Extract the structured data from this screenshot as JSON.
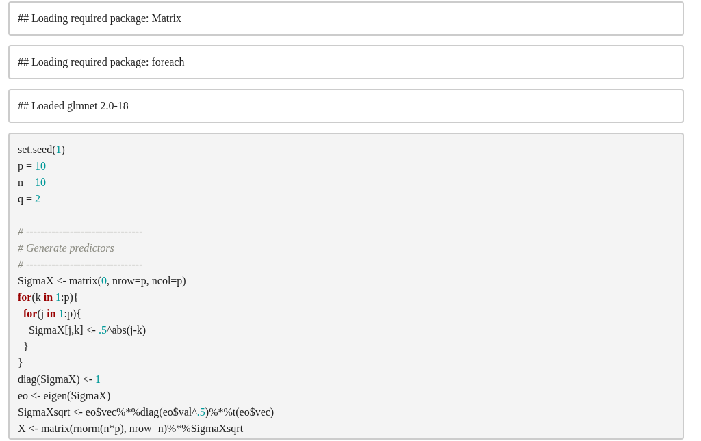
{
  "blocks": [
    {
      "kind": "output",
      "text": "## Loading required package: Matrix"
    },
    {
      "kind": "output",
      "text": "## Loading required package: foreach"
    },
    {
      "kind": "output",
      "text": "## Loaded glmnet 2.0-18"
    },
    {
      "kind": "code",
      "lines": [
        {
          "kind": "code",
          "tokens": [
            {
              "kind": "plain",
              "t": "set.seed("
            },
            {
              "kind": "number",
              "t": "1"
            },
            {
              "kind": "plain",
              "t": ")"
            }
          ]
        },
        {
          "kind": "code",
          "tokens": [
            {
              "kind": "plain",
              "t": "p = "
            },
            {
              "kind": "number",
              "t": "10"
            }
          ]
        },
        {
          "kind": "code",
          "tokens": [
            {
              "kind": "plain",
              "t": "n = "
            },
            {
              "kind": "number",
              "t": "10"
            }
          ]
        },
        {
          "kind": "code",
          "tokens": [
            {
              "kind": "plain",
              "t": "q = "
            },
            {
              "kind": "number",
              "t": "2"
            }
          ]
        },
        {
          "kind": "blank"
        },
        {
          "kind": "code",
          "tokens": [
            {
              "kind": "comment",
              "t": "# --------------------------------"
            }
          ]
        },
        {
          "kind": "code",
          "tokens": [
            {
              "kind": "comment",
              "t": "# Generate predictors"
            }
          ]
        },
        {
          "kind": "code",
          "tokens": [
            {
              "kind": "comment",
              "t": "# --------------------------------"
            }
          ]
        },
        {
          "kind": "code",
          "tokens": [
            {
              "kind": "plain",
              "t": "SigmaX <- matrix("
            },
            {
              "kind": "number",
              "t": "0"
            },
            {
              "kind": "plain",
              "t": ", nrow=p, ncol=p)"
            }
          ]
        },
        {
          "kind": "code",
          "tokens": [
            {
              "kind": "keyword",
              "t": "for"
            },
            {
              "kind": "plain",
              "t": "(k "
            },
            {
              "kind": "keyword",
              "t": "in"
            },
            {
              "kind": "number",
              "t": " 1"
            },
            {
              "kind": "plain",
              "t": ":p){"
            }
          ]
        },
        {
          "kind": "code",
          "tokens": [
            {
              "kind": "keyword",
              "t": "  for"
            },
            {
              "kind": "plain",
              "t": "(j "
            },
            {
              "kind": "keyword",
              "t": "in"
            },
            {
              "kind": "number",
              "t": " 1"
            },
            {
              "kind": "plain",
              "t": ":p){"
            }
          ]
        },
        {
          "kind": "code",
          "tokens": [
            {
              "kind": "plain",
              "t": "    SigmaX[j,k] <- "
            },
            {
              "kind": "number",
              "t": ".5"
            },
            {
              "kind": "plain",
              "t": "^abs(j-k)"
            }
          ]
        },
        {
          "kind": "code",
          "tokens": [
            {
              "kind": "plain",
              "t": "  }"
            }
          ]
        },
        {
          "kind": "code",
          "tokens": [
            {
              "kind": "plain",
              "t": "}"
            }
          ]
        },
        {
          "kind": "code",
          "tokens": [
            {
              "kind": "plain",
              "t": "diag(SigmaX) <- "
            },
            {
              "kind": "number",
              "t": "1"
            }
          ]
        },
        {
          "kind": "code",
          "tokens": [
            {
              "kind": "plain",
              "t": "eo <- eigen(SigmaX)"
            }
          ]
        },
        {
          "kind": "code",
          "tokens": [
            {
              "kind": "plain",
              "t": "SigmaXsqrt <- eo$vec%*%diag(eo$val^"
            },
            {
              "kind": "number",
              "t": ".5"
            },
            {
              "kind": "plain",
              "t": ")%*%t(eo$vec)"
            }
          ]
        },
        {
          "kind": "code",
          "tokens": [
            {
              "kind": "plain",
              "t": "X <- matrix(rnorm(n*p), nrow=n)%*%SigmaXsqrt"
            }
          ]
        }
      ]
    }
  ]
}
